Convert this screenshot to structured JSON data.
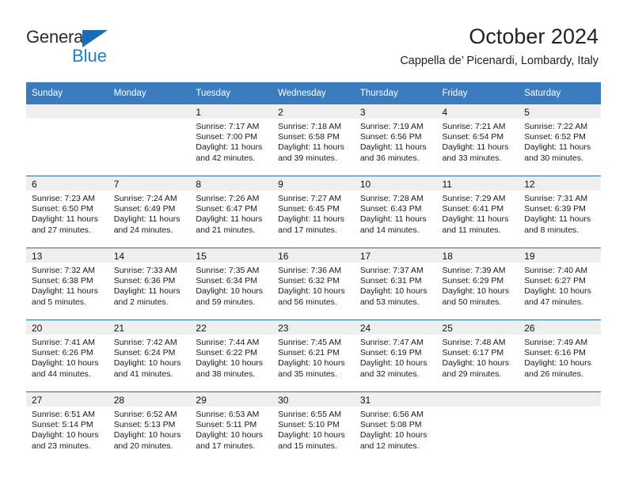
{
  "logo": {
    "word_top": "General",
    "word_bottom": "Blue",
    "triangle_color": "#1b6cb5",
    "blue_color": "#1b7fd4"
  },
  "header": {
    "title": "October 2024",
    "subtitle": "Cappella de’ Picenardi, Lombardy, Italy"
  },
  "theme": {
    "header_bg": "#3a7cbe",
    "row_divider": "#2e6da4",
    "daynum_band_bg": "#efefef"
  },
  "weekday_headers": [
    "Sunday",
    "Monday",
    "Tuesday",
    "Wednesday",
    "Thursday",
    "Friday",
    "Saturday"
  ],
  "weeks": [
    [
      {
        "day": "",
        "lines": []
      },
      {
        "day": "",
        "lines": []
      },
      {
        "day": "1",
        "lines": [
          "Sunrise: 7:17 AM",
          "Sunset: 7:00 PM",
          "Daylight: 11 hours",
          "and 42 minutes."
        ]
      },
      {
        "day": "2",
        "lines": [
          "Sunrise: 7:18 AM",
          "Sunset: 6:58 PM",
          "Daylight: 11 hours",
          "and 39 minutes."
        ]
      },
      {
        "day": "3",
        "lines": [
          "Sunrise: 7:19 AM",
          "Sunset: 6:56 PM",
          "Daylight: 11 hours",
          "and 36 minutes."
        ]
      },
      {
        "day": "4",
        "lines": [
          "Sunrise: 7:21 AM",
          "Sunset: 6:54 PM",
          "Daylight: 11 hours",
          "and 33 minutes."
        ]
      },
      {
        "day": "5",
        "lines": [
          "Sunrise: 7:22 AM",
          "Sunset: 6:52 PM",
          "Daylight: 11 hours",
          "and 30 minutes."
        ]
      }
    ],
    [
      {
        "day": "6",
        "lines": [
          "Sunrise: 7:23 AM",
          "Sunset: 6:50 PM",
          "Daylight: 11 hours",
          "and 27 minutes."
        ]
      },
      {
        "day": "7",
        "lines": [
          "Sunrise: 7:24 AM",
          "Sunset: 6:49 PM",
          "Daylight: 11 hours",
          "and 24 minutes."
        ]
      },
      {
        "day": "8",
        "lines": [
          "Sunrise: 7:26 AM",
          "Sunset: 6:47 PM",
          "Daylight: 11 hours",
          "and 21 minutes."
        ]
      },
      {
        "day": "9",
        "lines": [
          "Sunrise: 7:27 AM",
          "Sunset: 6:45 PM",
          "Daylight: 11 hours",
          "and 17 minutes."
        ]
      },
      {
        "day": "10",
        "lines": [
          "Sunrise: 7:28 AM",
          "Sunset: 6:43 PM",
          "Daylight: 11 hours",
          "and 14 minutes."
        ]
      },
      {
        "day": "11",
        "lines": [
          "Sunrise: 7:29 AM",
          "Sunset: 6:41 PM",
          "Daylight: 11 hours",
          "and 11 minutes."
        ]
      },
      {
        "day": "12",
        "lines": [
          "Sunrise: 7:31 AM",
          "Sunset: 6:39 PM",
          "Daylight: 11 hours",
          "and 8 minutes."
        ]
      }
    ],
    [
      {
        "day": "13",
        "lines": [
          "Sunrise: 7:32 AM",
          "Sunset: 6:38 PM",
          "Daylight: 11 hours",
          "and 5 minutes."
        ]
      },
      {
        "day": "14",
        "lines": [
          "Sunrise: 7:33 AM",
          "Sunset: 6:36 PM",
          "Daylight: 11 hours",
          "and 2 minutes."
        ]
      },
      {
        "day": "15",
        "lines": [
          "Sunrise: 7:35 AM",
          "Sunset: 6:34 PM",
          "Daylight: 10 hours",
          "and 59 minutes."
        ]
      },
      {
        "day": "16",
        "lines": [
          "Sunrise: 7:36 AM",
          "Sunset: 6:32 PM",
          "Daylight: 10 hours",
          "and 56 minutes."
        ]
      },
      {
        "day": "17",
        "lines": [
          "Sunrise: 7:37 AM",
          "Sunset: 6:31 PM",
          "Daylight: 10 hours",
          "and 53 minutes."
        ]
      },
      {
        "day": "18",
        "lines": [
          "Sunrise: 7:39 AM",
          "Sunset: 6:29 PM",
          "Daylight: 10 hours",
          "and 50 minutes."
        ]
      },
      {
        "day": "19",
        "lines": [
          "Sunrise: 7:40 AM",
          "Sunset: 6:27 PM",
          "Daylight: 10 hours",
          "and 47 minutes."
        ]
      }
    ],
    [
      {
        "day": "20",
        "lines": [
          "Sunrise: 7:41 AM",
          "Sunset: 6:26 PM",
          "Daylight: 10 hours",
          "and 44 minutes."
        ]
      },
      {
        "day": "21",
        "lines": [
          "Sunrise: 7:42 AM",
          "Sunset: 6:24 PM",
          "Daylight: 10 hours",
          "and 41 minutes."
        ]
      },
      {
        "day": "22",
        "lines": [
          "Sunrise: 7:44 AM",
          "Sunset: 6:22 PM",
          "Daylight: 10 hours",
          "and 38 minutes."
        ]
      },
      {
        "day": "23",
        "lines": [
          "Sunrise: 7:45 AM",
          "Sunset: 6:21 PM",
          "Daylight: 10 hours",
          "and 35 minutes."
        ]
      },
      {
        "day": "24",
        "lines": [
          "Sunrise: 7:47 AM",
          "Sunset: 6:19 PM",
          "Daylight: 10 hours",
          "and 32 minutes."
        ]
      },
      {
        "day": "25",
        "lines": [
          "Sunrise: 7:48 AM",
          "Sunset: 6:17 PM",
          "Daylight: 10 hours",
          "and 29 minutes."
        ]
      },
      {
        "day": "26",
        "lines": [
          "Sunrise: 7:49 AM",
          "Sunset: 6:16 PM",
          "Daylight: 10 hours",
          "and 26 minutes."
        ]
      }
    ],
    [
      {
        "day": "27",
        "lines": [
          "Sunrise: 6:51 AM",
          "Sunset: 5:14 PM",
          "Daylight: 10 hours",
          "and 23 minutes."
        ]
      },
      {
        "day": "28",
        "lines": [
          "Sunrise: 6:52 AM",
          "Sunset: 5:13 PM",
          "Daylight: 10 hours",
          "and 20 minutes."
        ]
      },
      {
        "day": "29",
        "lines": [
          "Sunrise: 6:53 AM",
          "Sunset: 5:11 PM",
          "Daylight: 10 hours",
          "and 17 minutes."
        ]
      },
      {
        "day": "30",
        "lines": [
          "Sunrise: 6:55 AM",
          "Sunset: 5:10 PM",
          "Daylight: 10 hours",
          "and 15 minutes."
        ]
      },
      {
        "day": "31",
        "lines": [
          "Sunrise: 6:56 AM",
          "Sunset: 5:08 PM",
          "Daylight: 10 hours",
          "and 12 minutes."
        ]
      },
      {
        "day": "",
        "lines": []
      },
      {
        "day": "",
        "lines": []
      }
    ]
  ]
}
